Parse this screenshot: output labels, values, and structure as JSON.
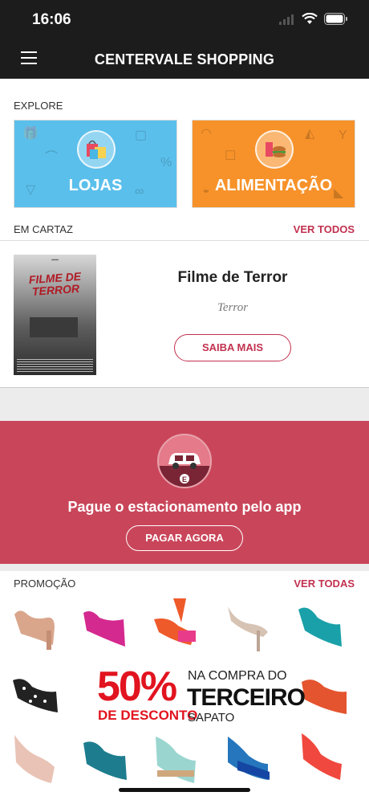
{
  "status_bar": {
    "time": "16:06"
  },
  "nav": {
    "title": "CENTERVALE SHOPPING",
    "menu_icon": "hamburger-menu-icon"
  },
  "explore": {
    "label": "EXPLORE",
    "tiles": [
      {
        "label": "LOJAS",
        "color": "#5bbfeb",
        "icon": "shopping-bags-icon"
      },
      {
        "label": "ALIMENTAÇÃO",
        "color": "#f7922a",
        "icon": "food-icon"
      }
    ]
  },
  "em_cartaz": {
    "label": "EM CARTAZ",
    "link": "VER TODOS",
    "movie": {
      "title": "Filme de Terror",
      "genre": "Terror",
      "poster_title": "FILME DE TERROR",
      "button": "SAIBA MAIS"
    }
  },
  "parking": {
    "text": "Pague o estacionamento pelo app",
    "button": "PAGAR AGORA",
    "color": "#c9465a"
  },
  "promocao": {
    "label": "PROMOÇÃO",
    "link": "VER TODAS",
    "banner": {
      "percent": "50%",
      "desconto": "DE DESCONTO",
      "line1": "NA COMPRA DO",
      "line2": "TERCEIRO",
      "line3": "SAPATO"
    }
  },
  "colors": {
    "accent": "#c2314f",
    "dark": "#1c1c1c"
  }
}
